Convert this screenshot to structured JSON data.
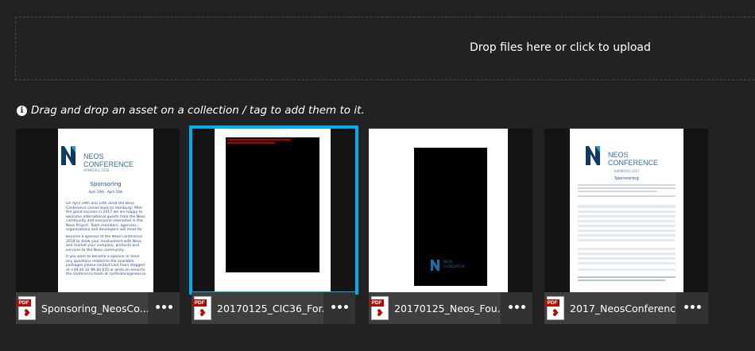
{
  "upload": {
    "label": "Drop files here or click to upload"
  },
  "hint": {
    "icon": "info-circle-icon",
    "text": "Drag and drop an asset on a collection / tag to add them to it."
  },
  "assets": [
    {
      "filename": "Sponsoring_NeosCo...",
      "type_badge": "PDF",
      "selected": false,
      "preview": {
        "brand_top": "NEOS",
        "brand_bottom": "CONFERENCE",
        "location": "HAMBURG 2018",
        "heading": "Sponsoring",
        "date": "April 19th - April 20th",
        "para1": "On April 19th and 14th 2018 the Neos Conference comes back to Hamburg! After the great success in 2017 we are happy to welcome international guests from the Neos community and everyone interested in the Neos Project. Team members, agencies, organisations and developers will meet for the Neos event of the year!",
        "para2": "Become a sponsor of the Neos Conference 2018 to show your involvement with Neos and market your company, products and services to the Neos community.",
        "para3": "If you want to become a sponsor or have any questions related to the available packages please contact Lisa Fixen stagged at +49 40 32 89 84 035 or write an email to the conference team at conference@neos.io"
      }
    },
    {
      "filename": "20170125_CIC36_For...",
      "type_badge": "PDF",
      "selected": true
    },
    {
      "filename": "20170125_Neos_Fou...",
      "type_badge": "PDF",
      "selected": false,
      "preview": {
        "brand_top": "NEOS",
        "brand_bottom": "FOUNDATION"
      }
    },
    {
      "filename": "2017_NeosConferenc...",
      "type_badge": "PDF",
      "selected": false,
      "preview": {
        "brand_top": "NEOS",
        "brand_bottom": "CONFERENCE",
        "location": "HAMBURG 2017",
        "heading": "Sponsoring"
      }
    }
  ],
  "more_label": "•••",
  "colors": {
    "selection": "#00adee",
    "pdf_red": "#b30b00",
    "background": "#222222",
    "caption_bg": "#3f3f3f"
  }
}
